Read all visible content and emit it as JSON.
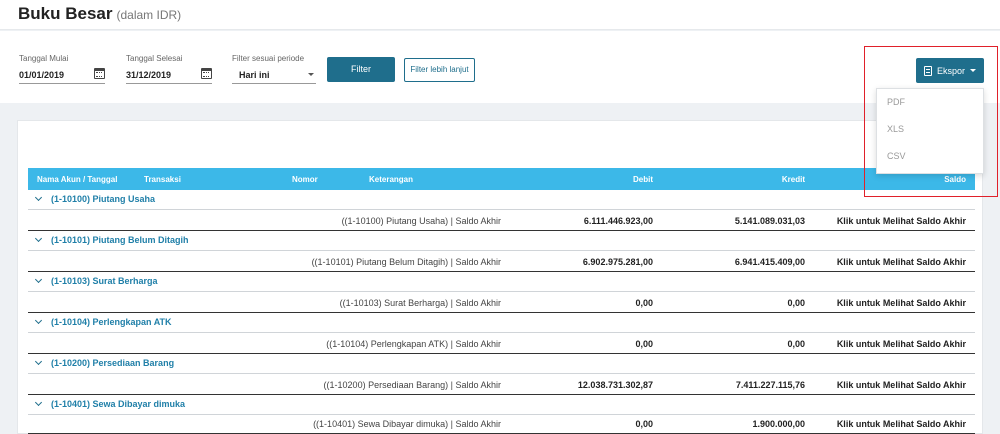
{
  "page": {
    "title": "Buku Besar",
    "subtitle": "(dalam IDR)"
  },
  "filters": {
    "start_label": "Tanggal Mulai",
    "start_value": "01/01/2019",
    "end_label": "Tanggal Selesai",
    "end_value": "31/12/2019",
    "period_label": "Filter sesuai periode",
    "period_value": "Hari ini",
    "filter_button": "Filter",
    "advanced_button": "Filter lebih lanjut"
  },
  "export": {
    "button_label": "Ekspor",
    "options": [
      "PDF",
      "XLS",
      "CSV"
    ]
  },
  "table": {
    "headers": {
      "account": "Nama Akun / Tanggal",
      "transaction": "Transaksi",
      "number": "Nomor",
      "description": "Keterangan",
      "debit": "Debit",
      "credit": "Kredit",
      "balance": "Saldo"
    },
    "groups": [
      {
        "name": "(1-10100) Piutang Usaha",
        "desc": "((1-10100) Piutang Usaha) | Saldo Akhir",
        "debit": "6.111.446.923,00",
        "credit": "5.141.089.031,03",
        "balance": "Klik untuk Melihat Saldo Akhir"
      },
      {
        "name": "(1-10101) Piutang Belum Ditagih",
        "desc": "((1-10101) Piutang Belum Ditagih) | Saldo Akhir",
        "debit": "6.902.975.281,00",
        "credit": "6.941.415.409,00",
        "balance": "Klik untuk Melihat Saldo Akhir"
      },
      {
        "name": "(1-10103) Surat Berharga",
        "desc": "((1-10103) Surat Berharga) | Saldo Akhir",
        "debit": "0,00",
        "credit": "0,00",
        "balance": "Klik untuk Melihat Saldo Akhir"
      },
      {
        "name": "(1-10104) Perlengkapan ATK",
        "desc": "((1-10104) Perlengkapan ATK) | Saldo Akhir",
        "debit": "0,00",
        "credit": "0,00",
        "balance": "Klik untuk Melihat Saldo Akhir"
      },
      {
        "name": "(1-10200) Persediaan Barang",
        "desc": "((1-10200) Persediaan Barang) | Saldo Akhir",
        "debit": "12.038.731.302,87",
        "credit": "7.411.227.115,76",
        "balance": "Klik untuk Melihat Saldo Akhir"
      },
      {
        "name": "(1-10401) Sewa Dibayar dimuka",
        "desc": "((1-10401) Sewa Dibayar dimuka) | Saldo Akhir",
        "debit": "0,00",
        "credit": "1.900.000,00",
        "balance": "Klik untuk Melihat Saldo Akhir"
      }
    ]
  }
}
